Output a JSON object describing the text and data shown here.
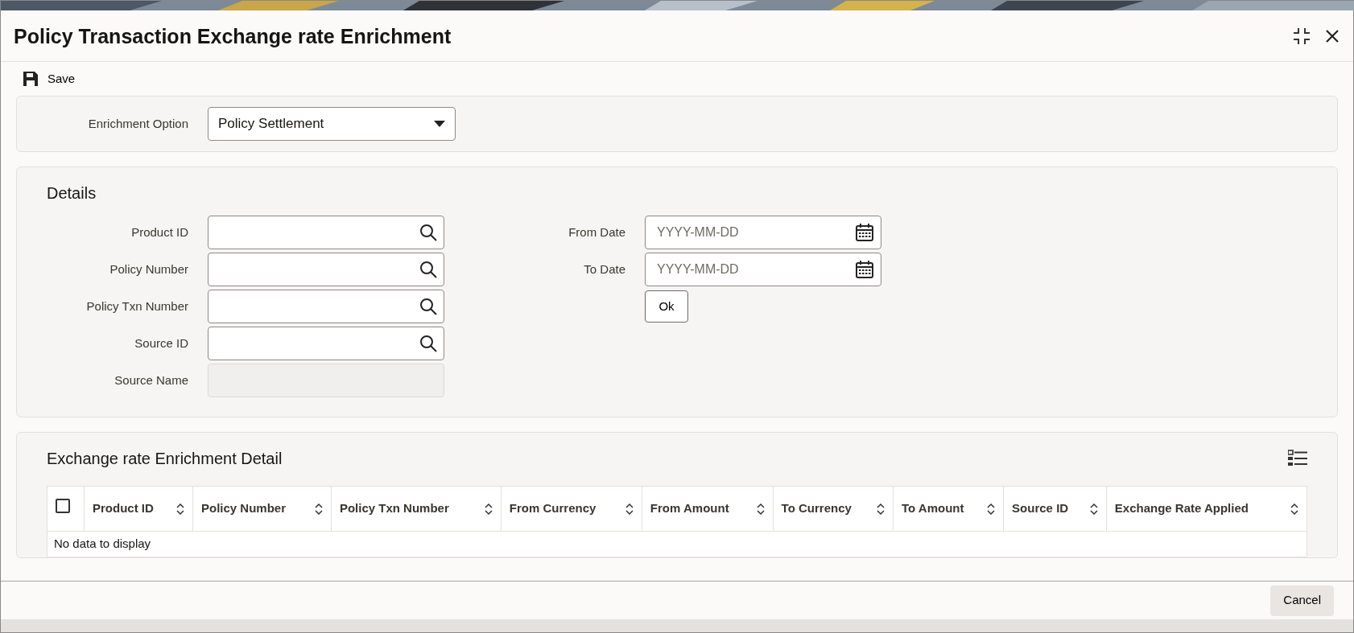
{
  "window": {
    "title": "Policy Transaction Exchange rate Enrichment"
  },
  "toolbar": {
    "save": "Save"
  },
  "enrichment": {
    "label": "Enrichment Option",
    "value": "Policy Settlement"
  },
  "details": {
    "title": "Details",
    "left_fields": [
      {
        "label": "Product ID",
        "kind": "lookup",
        "disabled": false
      },
      {
        "label": "Policy Number",
        "kind": "lookup",
        "disabled": false
      },
      {
        "label": "Policy Txn Number",
        "kind": "lookup",
        "disabled": false
      },
      {
        "label": "Source ID",
        "kind": "lookup",
        "disabled": false
      },
      {
        "label": "Source Name",
        "kind": "text",
        "disabled": true
      }
    ],
    "right_fields": [
      {
        "label": "From Date",
        "placeholder": "YYYY-MM-DD"
      },
      {
        "label": "To Date",
        "placeholder": "YYYY-MM-DD"
      }
    ],
    "ok_button": "Ok"
  },
  "detail_table": {
    "title": "Exchange rate Enrichment Detail",
    "select_all_checked": false,
    "columns": [
      "Product ID",
      "Policy Number",
      "Policy Txn Number",
      "From Currency",
      "From Amount",
      "To Currency",
      "To Amount",
      "Source ID",
      "Exchange Rate Applied"
    ],
    "empty_message": "No data to display"
  },
  "footer": {
    "cancel": "Cancel"
  }
}
